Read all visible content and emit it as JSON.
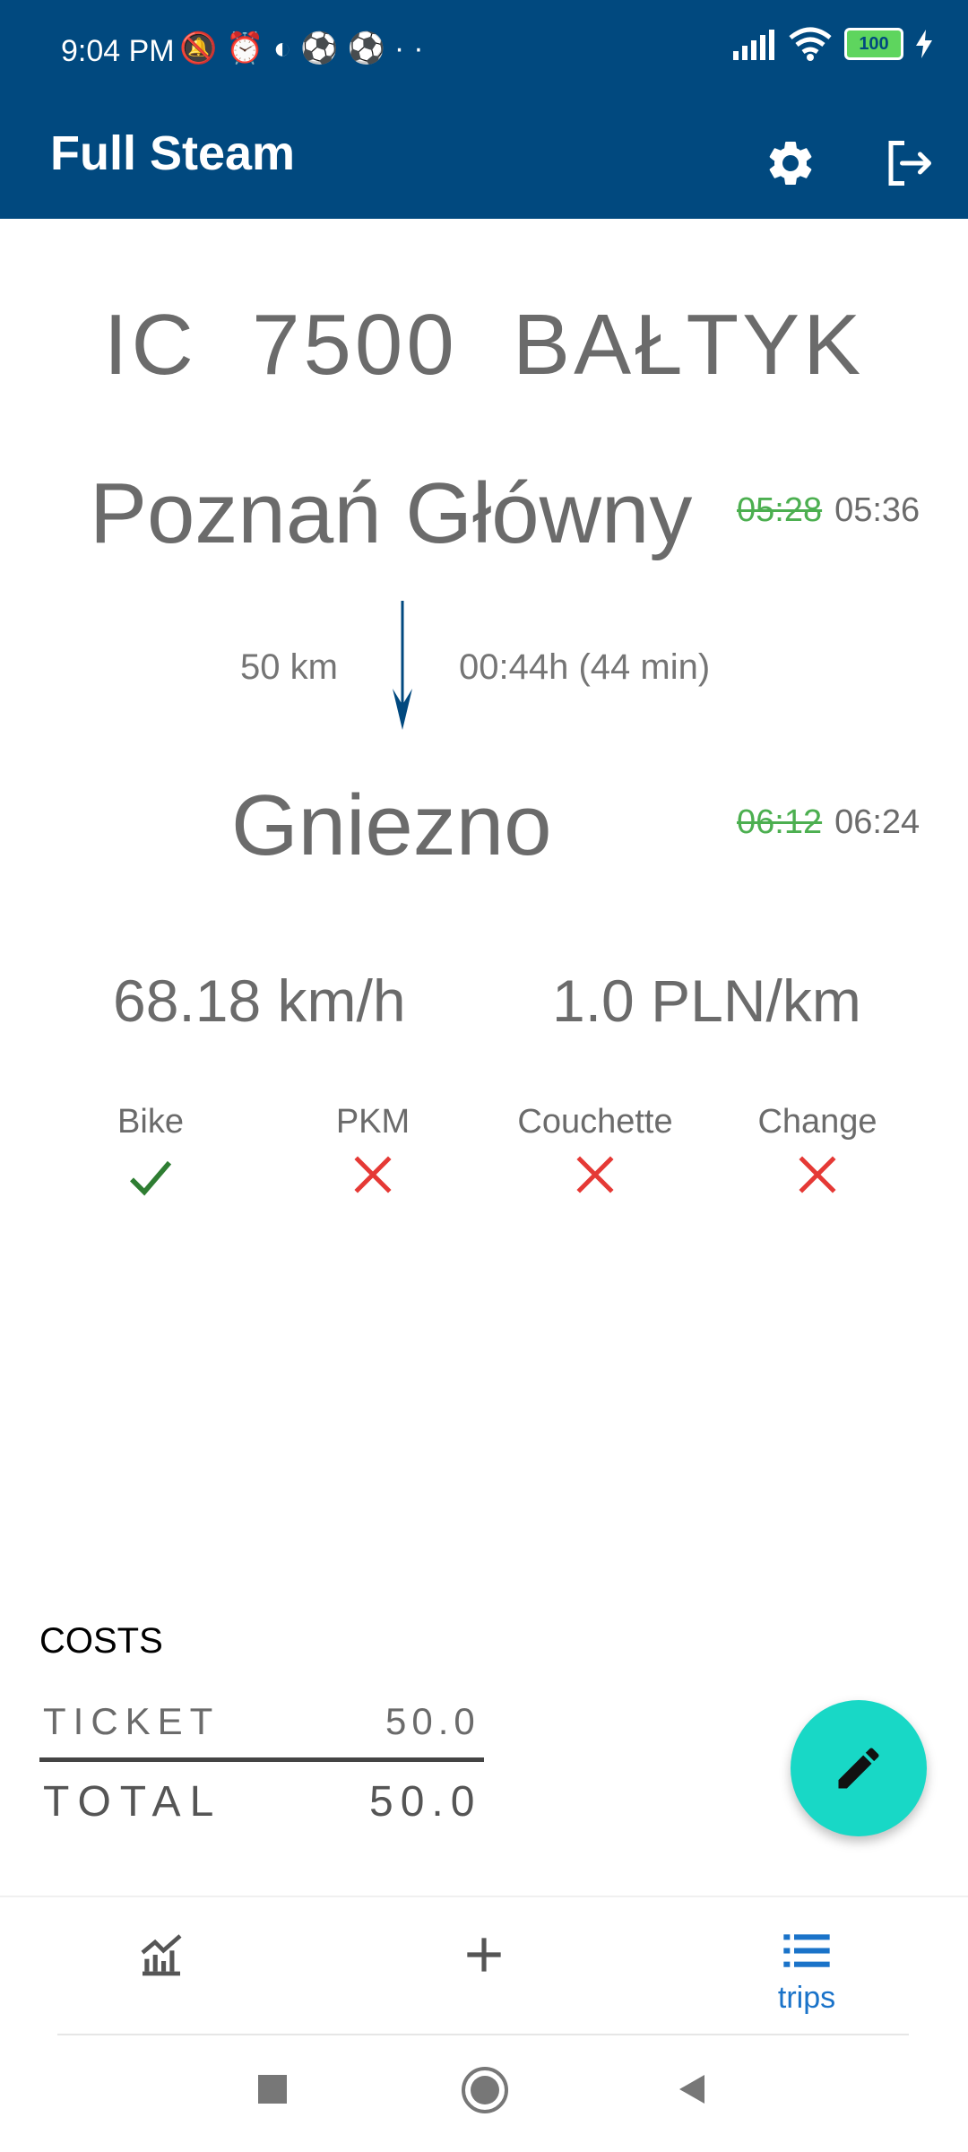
{
  "status_bar": {
    "time": "9:04 PM",
    "icons": [
      "mute-icon",
      "alarm-icon",
      "app-icon",
      "football-icon",
      "football-icon",
      "more-dots"
    ],
    "battery": "100"
  },
  "app_bar": {
    "title": "Full Steam",
    "actions": [
      "settings-icon",
      "logout-icon"
    ]
  },
  "trip": {
    "train": "IC  7500  BAŁTYK",
    "departure": {
      "station": "Poznań Główny",
      "scheduled": "05:28",
      "actual": "05:36"
    },
    "arrival": {
      "station": "Gniezno",
      "scheduled": "06:12",
      "actual": "06:24"
    },
    "distance": "50 km",
    "duration": "00:44h (44 min)",
    "speed": "68.18 km/h",
    "cost_per_km": "1.0 PLN/km",
    "features": [
      {
        "label": "Bike",
        "available": true
      },
      {
        "label": "PKM",
        "available": false
      },
      {
        "label": "Couchette",
        "available": false
      },
      {
        "label": "Change",
        "available": false
      }
    ]
  },
  "costs": {
    "title": "COSTS",
    "ticket_label": "TICKET",
    "ticket_value": "50.0",
    "total_label": "TOTAL",
    "total_value": "50.0"
  },
  "bottom_nav": {
    "items": [
      {
        "icon": "chart-icon",
        "label": ""
      },
      {
        "icon": "add-icon",
        "label": ""
      },
      {
        "icon": "list-icon",
        "label": "trips"
      }
    ]
  },
  "colors": {
    "primary": "#01497f",
    "accent": "#18d8c6",
    "check": "#2e7d32",
    "cross": "#e53935",
    "old_time": "#4caf50",
    "nav_active": "#1a73c9"
  }
}
